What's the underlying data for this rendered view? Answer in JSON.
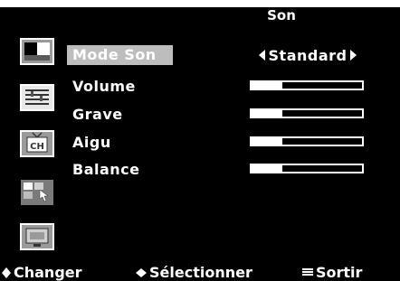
{
  "header": {
    "title": "Son"
  },
  "sidebar": {
    "icons": [
      {
        "name": "picture-icon"
      },
      {
        "name": "sound-icon"
      },
      {
        "name": "channel-icon"
      },
      {
        "name": "setup-icon"
      },
      {
        "name": "screen-icon"
      }
    ]
  },
  "menu": {
    "mode_son": {
      "label": "Mode Son",
      "value": "Standard"
    },
    "volume": {
      "label": "Volume",
      "level": 0.28
    },
    "grave": {
      "label": "Grave",
      "level": 0.28
    },
    "aigu": {
      "label": "Aigu",
      "level": 0.28
    },
    "balance": {
      "label": "Balance",
      "level": 0.28
    }
  },
  "footer": {
    "change": "Changer",
    "select": "Sélectionner",
    "exit": "Sortir"
  },
  "colors": {
    "background": "#000000",
    "text": "#ffffff",
    "highlight": "#bdbdbd"
  }
}
